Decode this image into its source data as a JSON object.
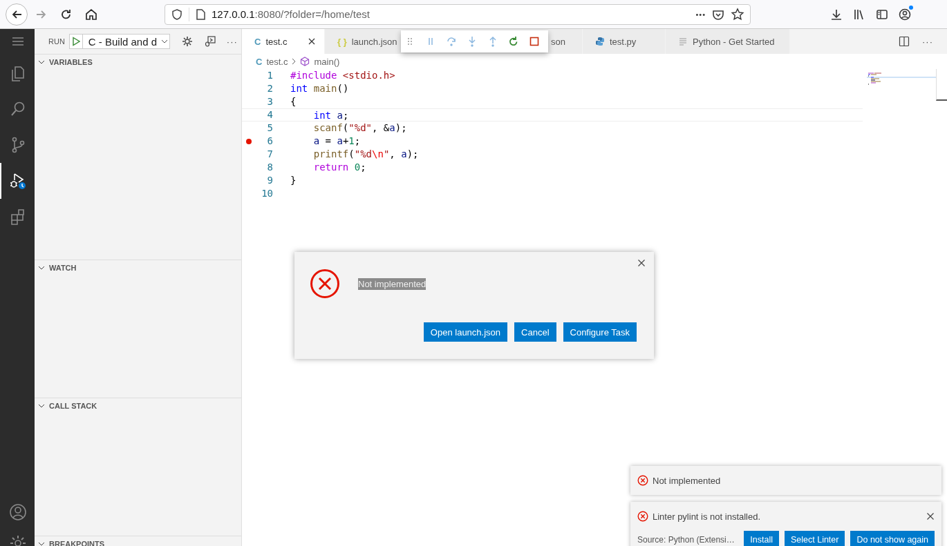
{
  "browser": {
    "nav": [
      {
        "kind": "back",
        "disabled": false
      },
      {
        "kind": "forward",
        "disabled": true
      },
      {
        "kind": "reload",
        "disabled": false
      },
      {
        "kind": "home",
        "disabled": false
      }
    ],
    "url": {
      "host": "127.0.0.1",
      "rest": ":8080/?folder=/home/test"
    },
    "url_actions": [
      {
        "kind": "more",
        "text": "•••"
      },
      {
        "kind": "pocket"
      },
      {
        "kind": "star"
      }
    ],
    "toolbar": [
      {
        "kind": "download"
      },
      {
        "kind": "library"
      },
      {
        "kind": "sidebar"
      },
      {
        "kind": "account",
        "badge": true
      }
    ]
  },
  "activity_bar": {
    "top": [
      {
        "kind": "menu",
        "selected": false
      },
      {
        "kind": "files",
        "selected": false
      },
      {
        "kind": "search",
        "selected": false
      },
      {
        "kind": "source-control",
        "selected": false
      },
      {
        "kind": "run-debug",
        "selected": true
      },
      {
        "kind": "extensions",
        "selected": false
      }
    ],
    "bottom": [
      {
        "kind": "account"
      },
      {
        "kind": "settings"
      }
    ]
  },
  "sidebar": {
    "title": "RUN",
    "configuration": "C - Build and d",
    "actions": [
      {
        "kind": "settings"
      },
      {
        "kind": "console"
      },
      {
        "kind": "more",
        "text": "···"
      }
    ],
    "sections": [
      {
        "title": "VARIABLES",
        "expanded": true
      },
      {
        "title": "WATCH",
        "expanded": true
      },
      {
        "title": "CALL STACK",
        "expanded": true
      },
      {
        "title": "BREAKPOINTS",
        "expanded": true
      }
    ]
  },
  "tabs": [
    {
      "label": "test.c",
      "icon": {
        "kind": "glyph",
        "text": "C",
        "color": "#519aba"
      },
      "selected": true,
      "closable": true
    },
    {
      "label": "launch.json",
      "icon": {
        "kind": "glyph",
        "text": "{ }",
        "color": "#cbcb41"
      },
      "selected": false,
      "closable": false
    },
    {
      "label": "son",
      "selected": false,
      "closable": false
    },
    {
      "label": "test.py",
      "icon": {
        "kind": "python"
      },
      "selected": false,
      "closable": false
    },
    {
      "label": "Python - Get Started",
      "icon": {
        "kind": "lines"
      },
      "selected": false,
      "closable": false
    }
  ],
  "editor_actions": [
    {
      "kind": "split"
    },
    {
      "kind": "more",
      "text": "···"
    }
  ],
  "debug_toolbar": [
    {
      "kind": "grip"
    },
    {
      "kind": "pause"
    },
    {
      "kind": "step-over"
    },
    {
      "kind": "step-into"
    },
    {
      "kind": "step-out"
    },
    {
      "kind": "restart"
    },
    {
      "kind": "stop"
    }
  ],
  "breadcrumb": [
    {
      "label": "test.c",
      "icon": {
        "kind": "glyph",
        "text": "C",
        "color": "#519aba"
      }
    },
    {
      "label": "main()",
      "icon": {
        "kind": "cube"
      }
    }
  ],
  "code": [
    {
      "number": "1",
      "breakpoint": false,
      "cursor": false,
      "tokens": [
        {
          "text": "#include",
          "kind": "directive"
        },
        {
          "text": " <stdio.h>",
          "kind": "string"
        }
      ]
    },
    {
      "number": "2",
      "breakpoint": false,
      "cursor": false,
      "tokens": [
        {
          "text": "int",
          "kind": "keyword"
        },
        {
          "text": " main",
          "kind": "function"
        },
        {
          "text": "()",
          "kind": "plain"
        }
      ]
    },
    {
      "number": "3",
      "breakpoint": false,
      "cursor": false,
      "tokens": [
        {
          "text": "{",
          "kind": "bracket"
        }
      ]
    },
    {
      "number": "4",
      "breakpoint": false,
      "cursor": true,
      "tokens": [
        {
          "text": "    int",
          "kind": "keyword"
        },
        {
          "text": " a",
          "kind": "variable"
        },
        {
          "text": ";",
          "kind": "plain"
        }
      ]
    },
    {
      "number": "5",
      "breakpoint": false,
      "cursor": false,
      "tokens": [
        {
          "text": "    scanf",
          "kind": "function"
        },
        {
          "text": "(",
          "kind": "plain"
        },
        {
          "text": "\"%d\"",
          "kind": "string"
        },
        {
          "text": ", &",
          "kind": "plain"
        },
        {
          "text": "a",
          "kind": "variable"
        },
        {
          "text": ");",
          "kind": "plain"
        }
      ]
    },
    {
      "number": "6",
      "breakpoint": true,
      "cursor": false,
      "tokens": [
        {
          "text": "    a",
          "kind": "variable"
        },
        {
          "text": " = ",
          "kind": "plain"
        },
        {
          "text": "a",
          "kind": "variable"
        },
        {
          "text": "+",
          "kind": "plain"
        },
        {
          "text": "1",
          "kind": "number"
        },
        {
          "text": ";",
          "kind": "plain"
        }
      ]
    },
    {
      "number": "7",
      "breakpoint": false,
      "cursor": false,
      "tokens": [
        {
          "text": "    printf",
          "kind": "function"
        },
        {
          "text": "(",
          "kind": "plain"
        },
        {
          "text": "\"%d",
          "kind": "string"
        },
        {
          "text": "\\n",
          "kind": "escape"
        },
        {
          "text": "\"",
          "kind": "string"
        },
        {
          "text": ", ",
          "kind": "plain"
        },
        {
          "text": "a",
          "kind": "variable"
        },
        {
          "text": ");",
          "kind": "plain"
        }
      ]
    },
    {
      "number": "8",
      "breakpoint": false,
      "cursor": false,
      "tokens": [
        {
          "text": "    return",
          "kind": "control"
        },
        {
          "text": " 0",
          "kind": "number"
        },
        {
          "text": ";",
          "kind": "plain"
        }
      ]
    },
    {
      "number": "9",
      "breakpoint": false,
      "cursor": false,
      "tokens": [
        {
          "text": "}",
          "kind": "bracket"
        }
      ]
    },
    {
      "number": "10",
      "breakpoint": false,
      "cursor": false
    }
  ],
  "dialog": {
    "message": "Not implemented",
    "highlighted": true,
    "buttons": [
      "Open launch.json",
      "Cancel",
      "Configure Task"
    ]
  },
  "notifications": [
    {
      "message": "Not implemented",
      "closable": false
    },
    {
      "message": "Linter pylint is not installed.",
      "closable": true,
      "source": "Source: Python (Extensi…",
      "actions": [
        "Install",
        "Select Linter",
        "Do not show again"
      ]
    }
  ]
}
